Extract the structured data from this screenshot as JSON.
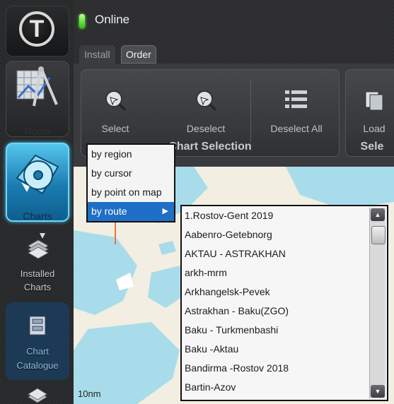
{
  "status": {
    "text": "Online",
    "indicator_color": "#2fd11a"
  },
  "tabs": [
    {
      "label": "Install"
    },
    {
      "label": "Order"
    }
  ],
  "sidebar": {
    "items": [
      {
        "label": "Route",
        "icon": "route-planner-icon"
      },
      {
        "label": "Charts",
        "icon": "chart-disc-icon"
      },
      {
        "label": "Installed\nCharts",
        "icon": "installed-charts-icon"
      },
      {
        "label": "Chart\nCatalogue",
        "icon": "chart-catalogue-icon"
      }
    ]
  },
  "ribbon": {
    "buttons": [
      {
        "label": "Select",
        "icon": "select-cursor-icon"
      },
      {
        "label": "Deselect",
        "icon": "deselect-cursor-icon"
      },
      {
        "label": "Deselect All",
        "icon": "list-icon"
      },
      {
        "label": "Load",
        "icon": "load-icon"
      }
    ],
    "group_titles": {
      "selection": "Chart Selection",
      "next": "Sele"
    }
  },
  "select_menu": {
    "items": [
      {
        "label": "by region"
      },
      {
        "label": "by cursor"
      },
      {
        "label": "by point on map"
      },
      {
        "label": "by route",
        "arrow": "▶"
      }
    ]
  },
  "routes": [
    "1.Rostov-Gent 2019",
    "Aabenro-Getebnorg",
    "AKTAU - ASTRAKHAN",
    "arkh-mrm",
    "Arkhangelsk-Pevek",
    "Astrakhan - Baku(ZGO)",
    "Baku - Turkmenbashi",
    "Baku -Aktau",
    "Bandirma -Rostov 2018",
    "Bartin-Azov"
  ],
  "map": {
    "scale_label": "10nm",
    "water_color": "#a9dcea",
    "land_color": "#f2eee2"
  },
  "accent_color": "#1f6fc6"
}
